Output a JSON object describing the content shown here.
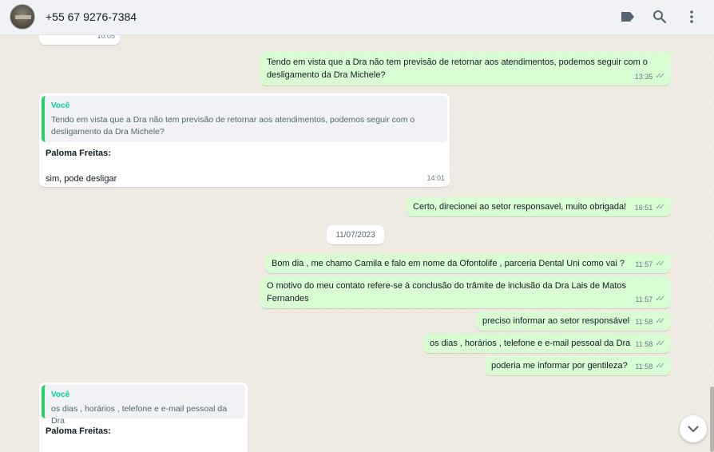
{
  "header": {
    "contact_name": "+55 67 9276-7384",
    "icons": [
      "label-icon",
      "search-icon",
      "menu-icon"
    ]
  },
  "messages": [
    {
      "id": "m0",
      "dir": "in",
      "text": "",
      "time": "10:05"
    },
    {
      "id": "m1",
      "dir": "out",
      "text": "Tendo em vista que a Dra não tem previsão de retornar aos atendimentos, podemos seguir com o desligamento da Dra Michele?",
      "time": "13:35"
    },
    {
      "id": "m2",
      "dir": "in",
      "quote_author": "Você",
      "quote_text": "Tendo em vista que a Dra não tem previsão de retornar aos atendimentos, podemos seguir com o desligamento da Dra Michele?",
      "sender": "Paloma Freitas:",
      "text": "sim, pode desligar",
      "time": "14:01"
    },
    {
      "id": "m3",
      "dir": "out",
      "text": "Certo, direcionei ao setor responsavel, muito obrigada!",
      "time": "16:51"
    },
    {
      "id": "m4",
      "dir": "out",
      "text": "Bom dia , me chamo Camila e falo em nome da Ofontolife , parceria Dental Uni como vai ?",
      "time": "11:57"
    },
    {
      "id": "m5",
      "dir": "out",
      "text": "O motivo do meu contato refere-se à conclusão do trâmite de inclusão da Dra Lais de Matos Fernandes",
      "time": "11:57"
    },
    {
      "id": "m6",
      "dir": "out",
      "text": "preciso informar ao setor responsável",
      "time": "11:58"
    },
    {
      "id": "m7",
      "dir": "out",
      "text": "os dias , horários , telefone e e-mail pessoal da Dra",
      "time": "11:58"
    },
    {
      "id": "m8",
      "dir": "out",
      "text": "poderia me informar por gentileza?",
      "time": "11:58"
    },
    {
      "id": "m9",
      "dir": "in",
      "quote_author": "Você",
      "quote_text": "os dias , horários , telefone e e-mail pessoal da Dra",
      "sender": "Paloma Freitas:",
      "text": ""
    }
  ],
  "date_separator": "11/07/2023",
  "colors": {
    "outgoing": "#d9fdd3",
    "incoming": "#ffffff",
    "accent": "#25d366",
    "background": "#efeae2"
  }
}
